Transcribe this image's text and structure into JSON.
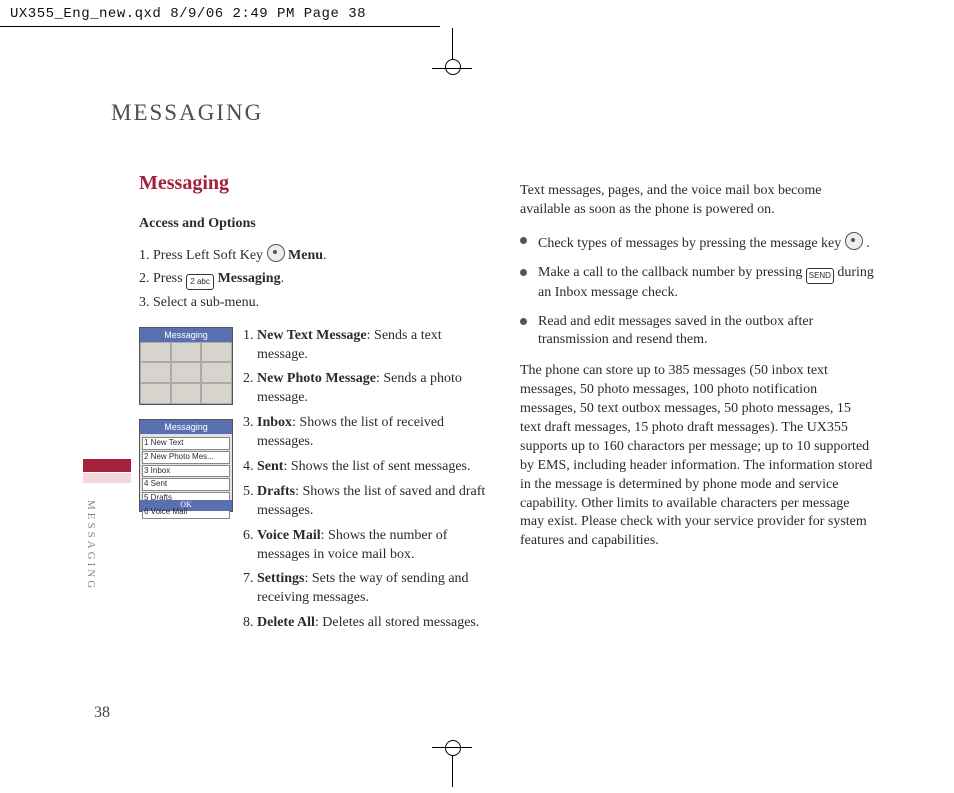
{
  "header_strip": "UX355_Eng_new.qxd  8/9/06  2:49 PM  Page 38",
  "page_title": "MESSAGING",
  "side_label": "MESSAGING",
  "page_number": "38",
  "section_head": "Messaging",
  "subhead": "Access and Options",
  "step1_a": "1. Press Left Soft Key ",
  "step1_b": " Menu",
  "step2_a": "2. Press ",
  "step2_key": "2 abc",
  "step2_b": " Messaging",
  "step3": "3. Select a sub-menu.",
  "thumb_title": "Messaging",
  "thumb_rows": {
    "r1": "1 New Text",
    "r2": "2 New Photo Mes...",
    "r3": "3 Inbox",
    "r4": "4 Sent",
    "r5": "5 Drafts",
    "r6": "6 Voice Mail"
  },
  "thumb_ok": "OK",
  "submenu": {
    "i1b": "New Text Message",
    "i1t": ": Sends a text message.",
    "i2b": "New Photo Message",
    "i2t": ": Sends a photo message.",
    "i3b": "Inbox",
    "i3t": ": Shows the list of received messages.",
    "i4b": "Sent",
    "i4t": ": Shows the list of sent messages.",
    "i5b": "Drafts",
    "i5t": ": Shows the list of saved and draft messages.",
    "i6b": "Voice Mail",
    "i6t": ": Shows the number of messages in voice mail box.",
    "i7b": "Settings",
    "i7t": ": Sets the way of sending and receiving messages.",
    "i8b": "Delete All",
    "i8t": ": Deletes all stored messages."
  },
  "right_intro": "Text messages, pages, and the voice mail box become available as soon as the phone is powered on.",
  "bullets": {
    "b1a": "Check types of messages by pressing the message key ",
    "b1b": ".",
    "b2a": "Make a call to the callback number by pressing ",
    "b2key": "SEND",
    "b2b": " during an Inbox message check.",
    "b3": "Read and edit messages saved in the outbox after transmission and resend them."
  },
  "right_para": "The phone can store up to 385 messages (50 inbox text messages, 50 photo messages, 100 photo notification messages, 50 text outbox messages, 50 photo messages, 15 text draft messages, 15 photo draft messages). The UX355 supports up to 160 charactors per message; up to 10 supported by EMS, including header information. The information stored in the message is determined by phone mode and service capability. Other limits to available characters per message may exist. Please check with your service provider for system features and capabilities."
}
